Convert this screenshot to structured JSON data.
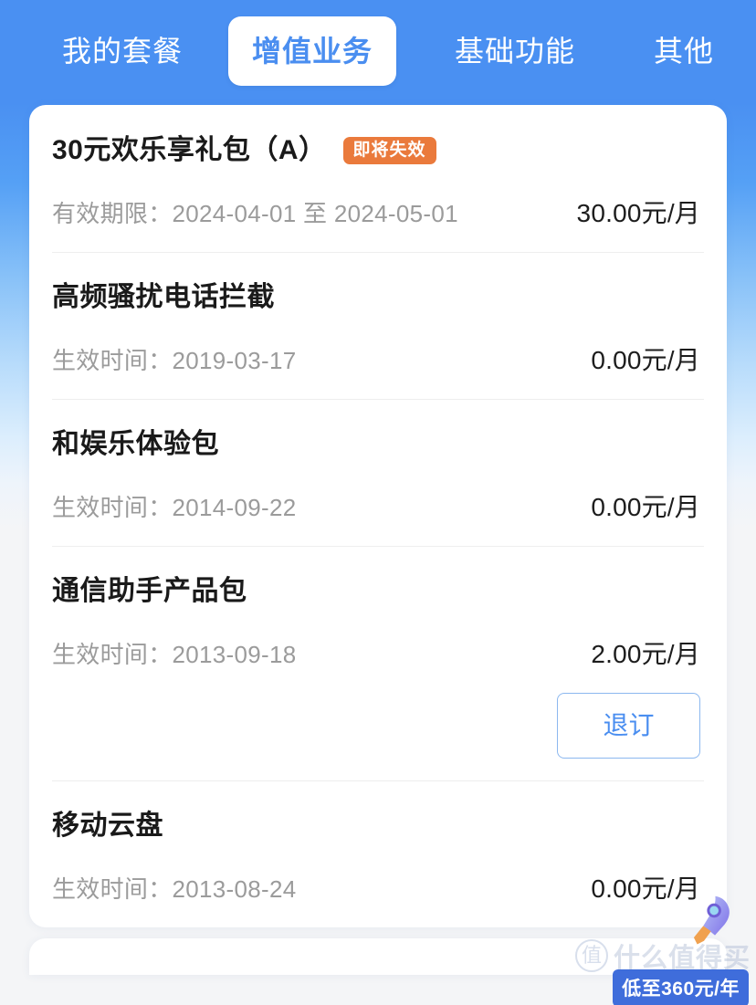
{
  "theme": {
    "brand_blue": "#4a90f2",
    "badge_orange": "#ea7a3c",
    "button_blue": "#4a8ef0",
    "page_background_bottom": "#f4f5f7"
  },
  "tabs": [
    {
      "label": "我的套餐",
      "active": false
    },
    {
      "label": "增值业务",
      "active": true
    },
    {
      "label": "基础功能",
      "active": false
    },
    {
      "label": "其他",
      "active": false
    }
  ],
  "services": [
    {
      "title": "30元欢乐享礼包（A）",
      "badge": "即将失效",
      "date_label": "有效期限：",
      "date_value": "2024-04-01 至 2024-05-01",
      "price": "30.00元/月",
      "action": null
    },
    {
      "title": "高频骚扰电话拦截",
      "badge": null,
      "date_label": "生效时间：",
      "date_value": "2019-03-17",
      "price": "0.00元/月",
      "action": null
    },
    {
      "title": "和娱乐体验包",
      "badge": null,
      "date_label": "生效时间：",
      "date_value": "2014-09-22",
      "price": "0.00元/月",
      "action": null
    },
    {
      "title": "通信助手产品包",
      "badge": null,
      "date_label": "生效时间：",
      "date_value": "2013-09-18",
      "price": "2.00元/月",
      "action": "退订"
    },
    {
      "title": "移动云盘",
      "badge": null,
      "date_label": "生效时间：",
      "date_value": "2013-08-24",
      "price": "0.00元/月",
      "action": null
    }
  ],
  "watermark": {
    "logo_glyph": "值",
    "site_name": "什么值得买",
    "rocket_icon": "rocket-icon",
    "banner_text": "低至360元/年"
  }
}
